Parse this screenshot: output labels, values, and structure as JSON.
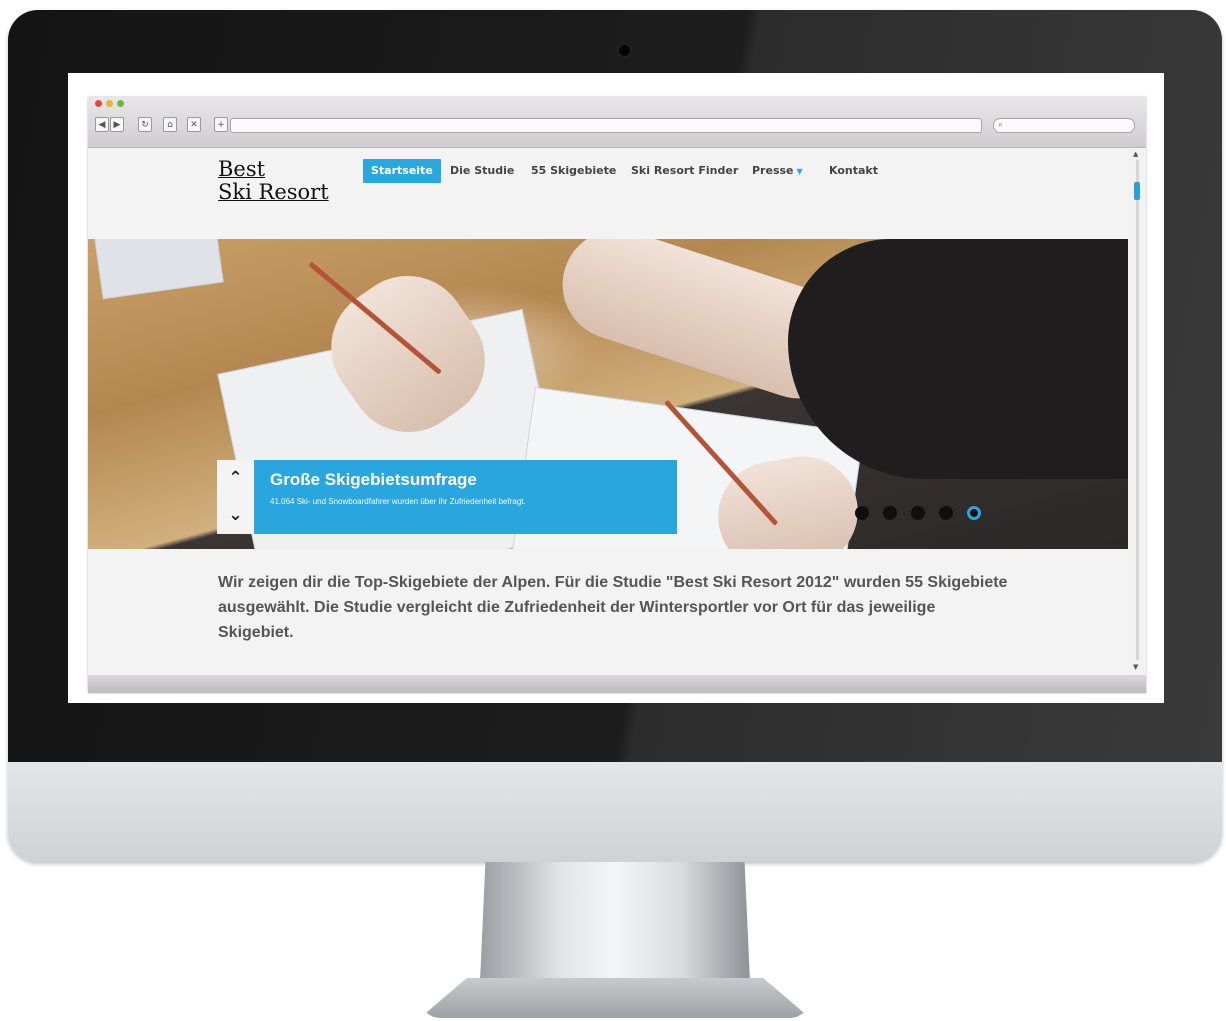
{
  "browser": {
    "search_glyph": "⌕"
  },
  "site": {
    "logo_line1": "Best",
    "logo_line2": "Ski Resort",
    "nav": {
      "startseite": "Startseite",
      "die_studie": "Die Studie",
      "skigebiete": "55 Skigebiete",
      "finder": "Ski Resort Finder",
      "presse": "Presse",
      "kontakt": "Kontakt"
    },
    "hero": {
      "title": "Große Skigebietsumfrage",
      "subtitle": "41.064 Ski- und Snowboardfahrer wurden über ihr Zufriedenheit befragt.",
      "slides_total": 5,
      "slide_active": 5
    },
    "intro": "Wir zeigen dir die Top-Skigebiete der Alpen. Für die Studie \"Best Ski Resort 2012\" wurden 55 Skigebiete ausgewählt. Die Studie vergleicht die Zufriedenheit der Wintersportler vor Ort für das jeweilige Skigebiet."
  },
  "colors": {
    "accent": "#2aa7de",
    "bezel": "#1a1a1a",
    "page_bg": "#f4f3f3"
  },
  "icons": {
    "back": "◀",
    "forward": "▶",
    "reload": "↻",
    "home": "⌂",
    "stop": "✕",
    "add": "+",
    "up": "⌃",
    "down": "⌄"
  }
}
